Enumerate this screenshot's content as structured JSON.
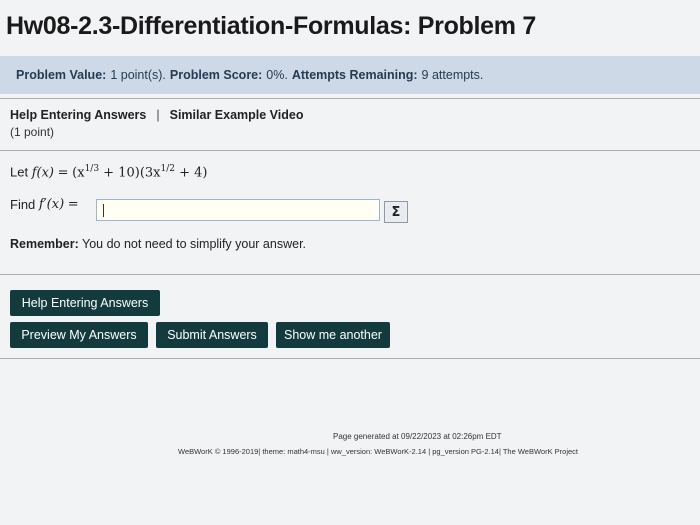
{
  "page_title": "Hw08-2.3-Differentiation-Formulas: Problem 7",
  "info_bar": {
    "value_label": "Problem Value:",
    "value_text": "1 point(s).",
    "score_label": "Problem Score:",
    "score_text": "0%.",
    "attempts_label": "Attempts Remaining:",
    "attempts_text": "9 attempts."
  },
  "help_links": {
    "help_entering": "Help Entering Answers",
    "separator": "|",
    "similar_video": "Similar Example Video",
    "points": "(1 point)"
  },
  "problem": {
    "let_label": "Let",
    "f_of_x": "f(x)",
    "equals": "=",
    "expr_part1": "(x",
    "exp1": "1/3",
    "expr_part2": " + 10)(3x",
    "exp2": "1/2",
    "expr_part3": " + 4)",
    "find_label": "Find",
    "f_prime": "f′(x)",
    "answer_value": "",
    "sigma_icon_glyph": "Σ"
  },
  "remember": {
    "label": "Remember:",
    "text": " You do not need to simplify your answer."
  },
  "buttons": {
    "help_entering": "Help Entering Answers",
    "preview": "Preview My Answers",
    "submit": "Submit Answers",
    "show_another": "Show me another"
  },
  "footer": {
    "generated": "Page generated at 09/22/2023 at 02:26pm EDT",
    "credits": "WeBWorK © 1996-2019| theme: math4-msu | ww_version: WeBWorK-2.14 | pg_version PG-2.14| The WeBWorK Project"
  },
  "colors": {
    "info_bar_bg": "#cdd9e6",
    "button_bg": "#133a3d",
    "input_bg": "#fffff4"
  }
}
